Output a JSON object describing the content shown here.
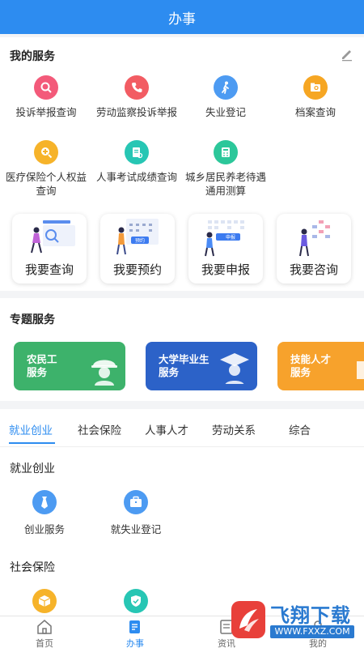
{
  "header": {
    "title": "办事"
  },
  "my_services": {
    "title": "我的服务",
    "edit_icon": "pencil-icon",
    "items": [
      {
        "label": "投诉举报查询",
        "icon": "search-doc-icon",
        "color": "#f35a7a"
      },
      {
        "label": "劳动监察投诉举报",
        "icon": "phone-icon",
        "color": "#f25c63"
      },
      {
        "label": "失业登记",
        "icon": "walking-person-icon",
        "color": "#4d9bf2"
      },
      {
        "label": "档案查询",
        "icon": "folder-search-icon",
        "color": "#f6a623"
      },
      {
        "label": "医疗保险个人权益查询",
        "icon": "medical-search-icon",
        "color": "#f6b32a"
      },
      {
        "label": "人事考试成绩查询",
        "icon": "exam-doc-icon",
        "color": "#27c6b4"
      },
      {
        "label": "城乡居民养老待遇通用测算",
        "icon": "calculator-icon",
        "color": "#2cc79a"
      }
    ]
  },
  "quick_cards": [
    {
      "label": "我要查询",
      "icon": "query-illustration-icon"
    },
    {
      "label": "我要预约",
      "icon": "appointment-illustration-icon",
      "tag": "预约"
    },
    {
      "label": "我要申报",
      "icon": "declare-illustration-icon",
      "tag": "申报"
    },
    {
      "label": "我要咨询",
      "icon": "consult-illustration-icon"
    }
  ],
  "topics": {
    "title": "专题服务",
    "items": [
      {
        "line1": "农民工",
        "line2": "服务",
        "icon": "worker-helmet-icon",
        "color": "#3db26b"
      },
      {
        "line1": "大学毕业生",
        "line2": "服务",
        "icon": "graduate-cap-icon",
        "color": "#2c62c8"
      },
      {
        "line1": "技能人才",
        "line2": "服务",
        "icon": "skilled-talent-icon",
        "color": "#f7a22c"
      }
    ]
  },
  "tabs": [
    {
      "label": "就业创业",
      "active": true
    },
    {
      "label": "社会保险",
      "active": false
    },
    {
      "label": "人事人才",
      "active": false
    },
    {
      "label": "劳动关系",
      "active": false
    },
    {
      "label": "综合",
      "active": false
    }
  ],
  "categories": [
    {
      "title": "就业创业",
      "items": [
        {
          "label": "创业服务",
          "icon": "tie-icon",
          "color": "#4d9bf2"
        },
        {
          "label": "就失业登记",
          "icon": "briefcase-icon",
          "color": "#4d9bf2"
        }
      ]
    },
    {
      "title": "社会保险",
      "items": [
        {
          "label": "",
          "icon": "box-icon",
          "color": "#f6b32a"
        },
        {
          "label": "",
          "icon": "shield-badge-icon",
          "color": "#27c6b4"
        }
      ]
    }
  ],
  "bottom_nav": [
    {
      "label": "首页",
      "icon": "home-icon",
      "active": false
    },
    {
      "label": "办事",
      "icon": "document-pen-icon",
      "active": true
    },
    {
      "label": "资讯",
      "icon": "news-icon",
      "active": false
    },
    {
      "label": "我的",
      "icon": "user-icon",
      "active": false
    }
  ],
  "watermark": {
    "cn": "飞翔下载",
    "en": "WWW.FXXZ.COM"
  }
}
